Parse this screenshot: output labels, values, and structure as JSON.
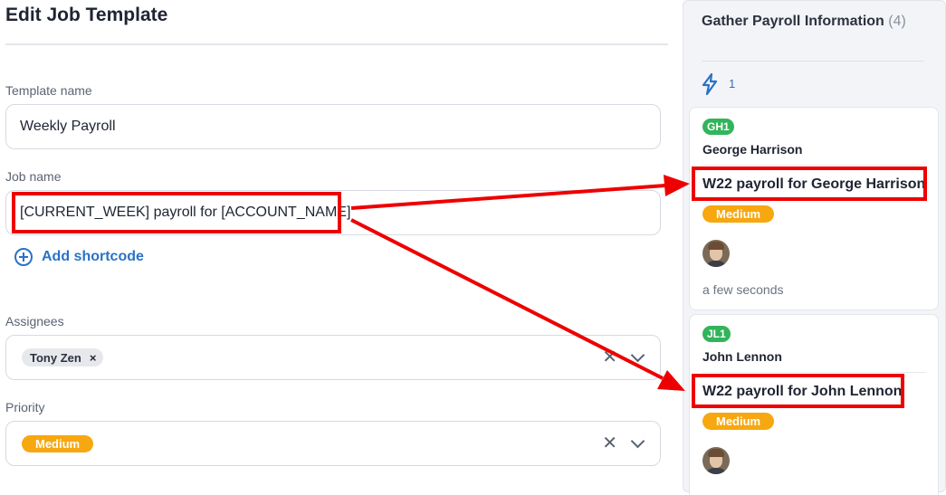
{
  "page": {
    "title": "Edit Job Template"
  },
  "form": {
    "template_name": {
      "label": "Template name",
      "value": "Weekly Payroll"
    },
    "job_name": {
      "label": "Job name",
      "value": "[CURRENT_WEEK] payroll for [ACCOUNT_NAME]"
    },
    "add_shortcode_label": "Add shortcode",
    "assignees": {
      "label": "Assignees",
      "chips": [
        {
          "label": "Tony Zen",
          "remove": "×"
        }
      ],
      "clear": "✕"
    },
    "priority": {
      "label": "Priority",
      "value": "Medium",
      "clear": "✕"
    }
  },
  "board": {
    "column": {
      "title": "Gather Payroll Information",
      "count": "(4)",
      "automation_count": "1"
    },
    "cards": [
      {
        "account_code": "GH1",
        "account_name": "George Harrison",
        "job_title": "W22 payroll for George Harrison",
        "priority": "Medium",
        "time": "a few seconds"
      },
      {
        "account_code": "JL1",
        "account_name": "John Lennon",
        "job_title": "W22 payroll for John Lennon",
        "priority": "Medium"
      }
    ]
  },
  "colors": {
    "accent": "#2a72c6",
    "priority_medium": "#f7a70f",
    "account_badge": "#32b45a",
    "annotation": "#ee0000"
  },
  "icons": [
    "plus-circle-icon",
    "remove-chip-icon",
    "clear-icon",
    "chevron-down-icon",
    "lightning-bolt-icon",
    "avatar"
  ]
}
